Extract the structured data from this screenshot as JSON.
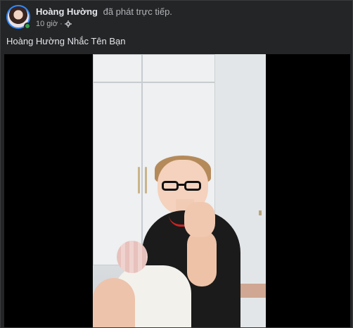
{
  "post": {
    "author_name": "Hoàng Hường",
    "action_text": "đã phát trực tiếp.",
    "time": "10 giờ",
    "separator": "·",
    "audience_icon": "gear-icon",
    "text": "Hoàng Hường Nhắc Tên Bạn"
  },
  "colors": {
    "background": "#242526",
    "text_primary": "#e4e6eb",
    "text_secondary": "#b0b3b8",
    "online": "#31a24c",
    "avatar_ring": "#2d88ff"
  },
  "video": {
    "type": "live-video-frame"
  }
}
